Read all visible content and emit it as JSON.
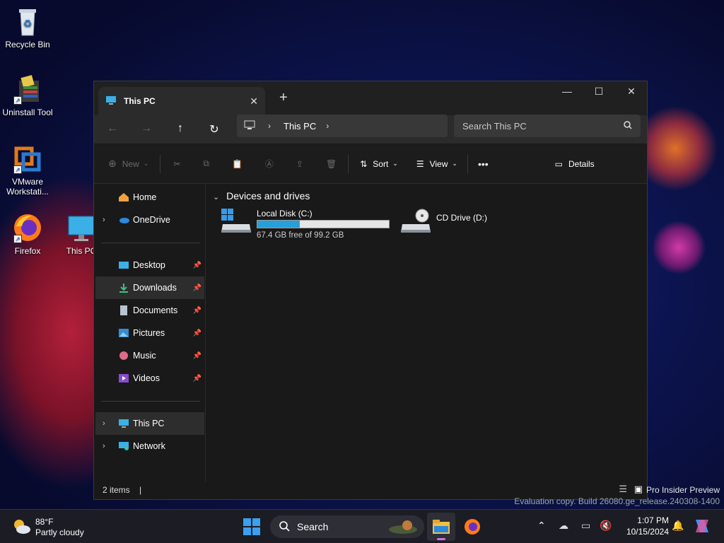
{
  "desktop": {
    "icons": [
      {
        "label": "Recycle Bin",
        "icon": "recycle-bin-icon"
      },
      {
        "label": "Uninstall Tool",
        "icon": "uninstall-tool-icon"
      },
      {
        "label": "VMware Workstati...",
        "icon": "vmware-icon"
      },
      {
        "label": "Firefox",
        "icon": "firefox-icon"
      },
      {
        "label": "This PC",
        "icon": "monitor-icon"
      }
    ],
    "watermark_line1": "Pro Insider Preview",
    "watermark_line2": "Evaluation copy. Build 26080.ge_release.240308-1400"
  },
  "explorer": {
    "tab_title": "This PC",
    "new_tab_symbol": "+",
    "breadcrumb": [
      "This PC"
    ],
    "search_placeholder": "Search This PC",
    "toolbar": {
      "new_label": "New",
      "sort_label": "Sort",
      "view_label": "View",
      "more_label": "•••",
      "details_label": "Details"
    },
    "sidebar": {
      "top": [
        {
          "label": "Home",
          "icon": "home-icon"
        },
        {
          "label": "OneDrive",
          "icon": "onedrive-icon"
        }
      ],
      "pinned": [
        {
          "label": "Desktop",
          "icon": "desktop-folder-icon"
        },
        {
          "label": "Downloads",
          "icon": "downloads-icon"
        },
        {
          "label": "Documents",
          "icon": "documents-icon"
        },
        {
          "label": "Pictures",
          "icon": "pictures-icon"
        },
        {
          "label": "Music",
          "icon": "music-icon"
        },
        {
          "label": "Videos",
          "icon": "videos-icon"
        }
      ],
      "bottom": [
        {
          "label": "This PC",
          "icon": "this-pc-icon"
        },
        {
          "label": "Network",
          "icon": "network-icon"
        }
      ]
    },
    "main": {
      "group_header": "Devices and drives",
      "drives": [
        {
          "name": "Local Disk (C:)",
          "free_text": "67.4 GB free of 99.2 GB",
          "used_fraction": 0.32
        },
        {
          "name": "CD Drive (D:)"
        }
      ]
    },
    "status": "2 items"
  },
  "taskbar": {
    "weather_temp": "88°F",
    "weather_desc": "Partly cloudy",
    "search_label": "Search",
    "time": "1:07 PM",
    "date": "10/15/2024"
  },
  "colors": {
    "accent": "#26a0da",
    "window_bg": "#191919",
    "selected": "#2d2d2d"
  }
}
